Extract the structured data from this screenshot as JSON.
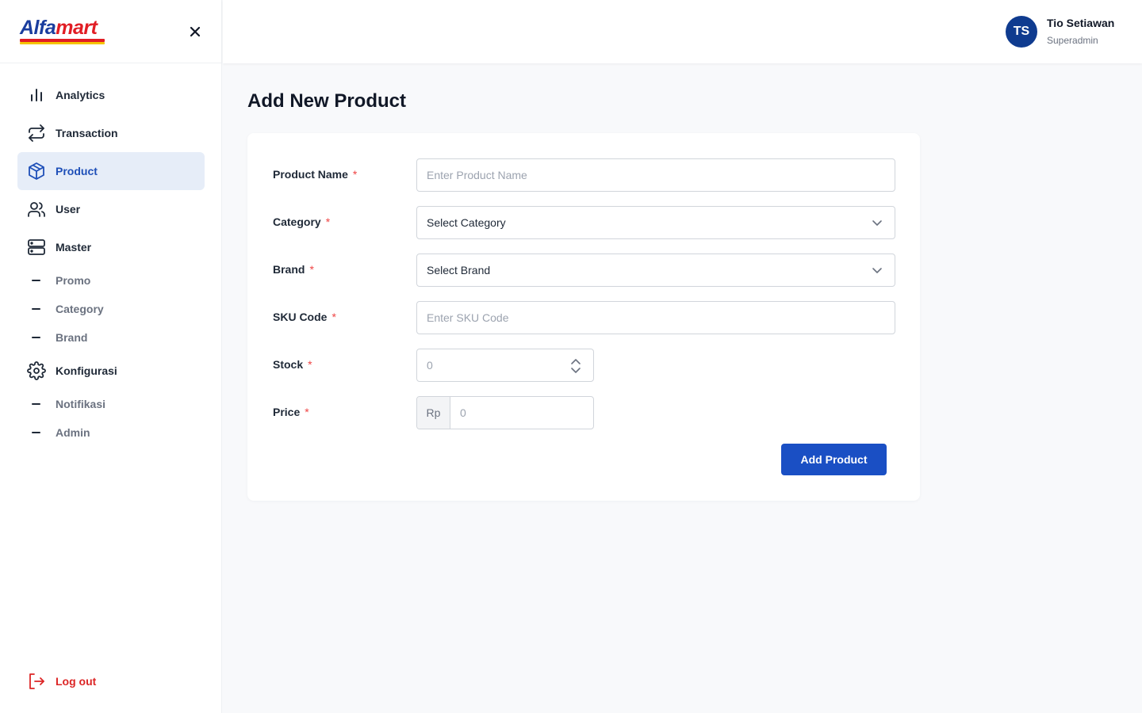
{
  "brand": {
    "logo_part1": "Alfa",
    "logo_part2": "mart"
  },
  "sidebar": {
    "items": [
      {
        "label": "Analytics",
        "icon": "bar-chart-icon"
      },
      {
        "label": "Transaction",
        "icon": "arrows-repeat-icon"
      },
      {
        "label": "Product",
        "icon": "cube-icon",
        "active": true
      },
      {
        "label": "User",
        "icon": "users-icon"
      },
      {
        "label": "Master",
        "icon": "server-icon",
        "children": [
          "Promo",
          "Category",
          "Brand"
        ]
      },
      {
        "label": "Konfigurasi",
        "icon": "gear-icon",
        "children": [
          "Notifikasi",
          "Admin"
        ]
      }
    ],
    "logout_label": "Log out"
  },
  "header": {
    "avatar_initials": "TS",
    "user_name": "Tio Setiawan",
    "user_role": "Superadmin"
  },
  "main": {
    "title": "Add New Product",
    "form": {
      "product_name": {
        "label": "Product Name",
        "required": "*",
        "placeholder": "Enter Product Name"
      },
      "category": {
        "label": "Category",
        "required": "*",
        "value": "Select Category"
      },
      "brand": {
        "label": "Brand",
        "required": "*",
        "value": "Select Brand"
      },
      "sku": {
        "label": "SKU Code",
        "required": "*",
        "placeholder": "Enter SKU Code"
      },
      "stock": {
        "label": "Stock",
        "required": "*",
        "value": "0"
      },
      "price": {
        "label": "Price",
        "required": "*",
        "prefix": "Rp",
        "value": "0"
      },
      "submit_label": "Add Product"
    }
  },
  "colors": {
    "primary": "#1a4fc4",
    "danger": "#dc2626",
    "active_bg": "#e6edf8",
    "avatar": "#0f3b8f"
  }
}
